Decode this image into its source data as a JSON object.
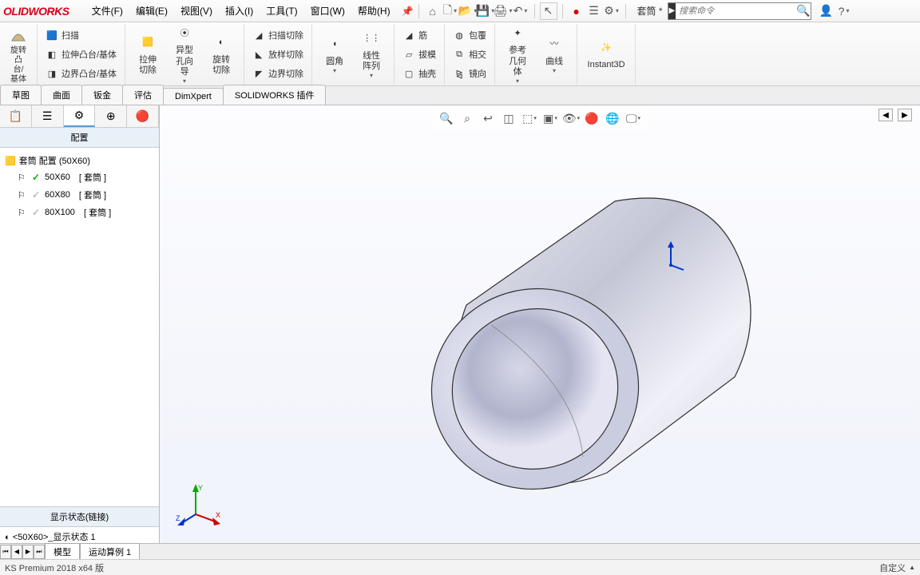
{
  "brand": "OLIDWORKS",
  "menu": {
    "file": "文件(F)",
    "edit": "编辑(E)",
    "view": "视图(V)",
    "insert": "插入(I)",
    "tools": "工具(T)",
    "window": "窗口(W)",
    "help": "帮助(H)"
  },
  "title_doc": "套筒 *",
  "search": {
    "placeholder": "搜索命令"
  },
  "ribbon": {
    "c1a": "扫描",
    "c1b": "拉伸凸台/基体",
    "c1c": "边界凸台/基体",
    "c1left1": "旋转凸台/基体",
    "c2a": "拉伸切除",
    "c2b": "异型孔向导",
    "c2c": "旋转切除",
    "c3a": "扫描切除",
    "c3b": "放样切除",
    "c3c": "边界切除",
    "c4a": "圆角",
    "c4b": "线性阵列",
    "c5a": "筋",
    "c5b": "拔模",
    "c5c": "抽壳",
    "c6a": "包覆",
    "c6b": "相交",
    "c6c": "镜向",
    "c7a": "参考几何体",
    "c7b": "曲线",
    "c8": "Instant3D"
  },
  "tabs": {
    "sketch": "草图",
    "surface": "曲面",
    "sheetmetal": "钣金",
    "evaluate": "评估",
    "dimxpert": "DimXpert",
    "addins": "SOLIDWORKS 插件"
  },
  "panel": {
    "title": "配置",
    "root": "套筒 配置  (50X60)",
    "items": [
      {
        "name": "50X60",
        "suffix": "[ 套筒 ]",
        "active": true
      },
      {
        "name": "60X80",
        "suffix": "[ 套筒 ]",
        "active": false
      },
      {
        "name": "80X100",
        "suffix": "[ 套筒 ]",
        "active": false
      }
    ],
    "state_title": "显示状态(链接)",
    "state_item": "<50X60>_显示状态 1"
  },
  "bottom_tabs": {
    "model": "模型",
    "motion": "运动算例 1"
  },
  "status": {
    "left": "KS Premium 2018 x64 版",
    "right": "自定义"
  }
}
